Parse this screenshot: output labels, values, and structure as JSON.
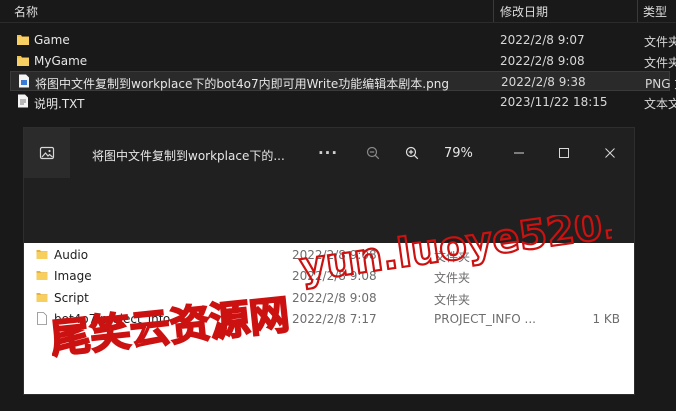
{
  "explorer": {
    "columns": {
      "name": "名称",
      "date": "修改日期",
      "type": "类型"
    },
    "files": [
      {
        "name": "Game",
        "date": "2022/2/8 9:07",
        "type": "文件夹",
        "icon": "folder-icon"
      },
      {
        "name": "MyGame",
        "date": "2022/2/8 9:08",
        "type": "文件夹",
        "icon": "folder-icon"
      },
      {
        "name": "将图中文件复制到workplace下的bot4o7内即可用Write功能编辑本剧本.png",
        "date": "2022/2/8 9:38",
        "type": "PNG 文件",
        "icon": "image-file-icon"
      },
      {
        "name": "说明.TXT",
        "date": "2023/11/22 18:15",
        "type": "文本文档",
        "icon": "text-file-icon"
      }
    ]
  },
  "viewer": {
    "title": "将图中文件复制到workplace下的...",
    "zoom": "79%",
    "more_label": "···",
    "image_rows": [
      {
        "name": "Audio",
        "date": "2022/2/8 9:08",
        "type": "文件夹",
        "size": ""
      },
      {
        "name": "Image",
        "date": "2022/2/8 9:08",
        "type": "文件夹",
        "size": ""
      },
      {
        "name": "Script",
        "date": "2022/2/8 9:08",
        "type": "文件夹",
        "size": ""
      },
      {
        "name": "bot4o7.project_info",
        "date": "2022/2/8 7:17",
        "type": "PROJECT_INFO ...",
        "size": "1 KB"
      }
    ]
  },
  "watermark": {
    "text_cn": "尾笑云资源网",
    "text_url": "yun.luoye520.cn",
    "color": "#cc1111"
  },
  "colors": {
    "folder": "#f2c14e",
    "background": "#191919"
  }
}
